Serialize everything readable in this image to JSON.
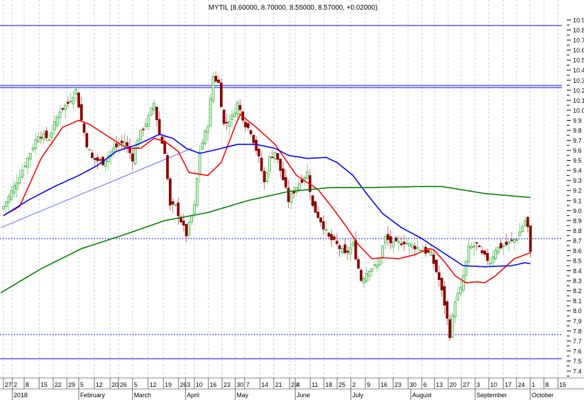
{
  "chart_data": {
    "type": "candlestick",
    "title": "MYTIL (8.60000, 8.70000, 8.55000, 8.57000, +0.02000)",
    "ylim": [
      7.4,
      10.9
    ],
    "y_ticks": [
      "7.4",
      "7.5",
      "7.6",
      "7.7",
      "7.8",
      "7.9",
      "8.0",
      "8.1",
      "8.2",
      "8.3",
      "8.4",
      "8.5",
      "8.6",
      "8.7",
      "8.8",
      "8.9",
      "9.0",
      "9.1",
      "9.2",
      "9.3",
      "9.4",
      "9.5",
      "9.6",
      "9.7",
      "9.8",
      "9.9",
      "10.0",
      "10.1",
      "10.2",
      "10.3",
      "10.4",
      "10.5",
      "10.6",
      "10.7",
      "10.8",
      "10.9"
    ],
    "x_day_range": [
      -1,
      209
    ],
    "week_ticks": [
      {
        "label": "27",
        "day": 0
      },
      {
        "label": "2",
        "day": 3.3
      },
      {
        "label": "8",
        "day": 7.7
      },
      {
        "label": "15",
        "day": 13.3
      },
      {
        "label": "22",
        "day": 18.5
      },
      {
        "label": "29",
        "day": 23.6
      },
      {
        "label": "5",
        "day": 28
      },
      {
        "label": "12",
        "day": 33.8
      },
      {
        "label": "20",
        "day": 39.7
      },
      {
        "label": "26",
        "day": 42.8
      },
      {
        "label": "5",
        "day": 48
      },
      {
        "label": "12",
        "day": 53.8
      },
      {
        "label": "19",
        "day": 59.5
      },
      {
        "label": "26",
        "day": 65.1
      },
      {
        "label": "3",
        "day": 67.7
      },
      {
        "label": "10",
        "day": 71
      },
      {
        "label": "16",
        "day": 76.2
      },
      {
        "label": "23",
        "day": 81.3
      },
      {
        "label": "30",
        "day": 86.2
      },
      {
        "label": "7",
        "day": 89.7
      },
      {
        "label": "14",
        "day": 95.4
      },
      {
        "label": "21",
        "day": 100.5
      },
      {
        "label": "29",
        "day": 106.4
      },
      {
        "label": "4",
        "day": 108.5
      },
      {
        "label": "11",
        "day": 114.1
      },
      {
        "label": "18",
        "day": 119.2
      },
      {
        "label": "25",
        "day": 124.1
      },
      {
        "label": "2",
        "day": 129.2
      },
      {
        "label": "9",
        "day": 134.6
      },
      {
        "label": "16",
        "day": 139.7
      },
      {
        "label": "23",
        "day": 144.9
      },
      {
        "label": "30",
        "day": 150.5
      },
      {
        "label": "6",
        "day": 155.6
      },
      {
        "label": "13",
        "day": 160.3
      },
      {
        "label": "20",
        "day": 165.4
      },
      {
        "label": "27",
        "day": 170.3
      },
      {
        "label": "3",
        "day": 175.4
      },
      {
        "label": "10",
        "day": 180.5
      },
      {
        "label": "17",
        "day": 185.9
      },
      {
        "label": "24",
        "day": 190.8
      },
      {
        "label": "1",
        "day": 195.9
      },
      {
        "label": "8",
        "day": 201
      },
      {
        "label": "15",
        "day": 206.2
      }
    ],
    "month_labels": [
      {
        "label": "2018",
        "day": 3.3
      },
      {
        "label": "February",
        "day": 28
      },
      {
        "label": "March",
        "day": 48
      },
      {
        "label": "April",
        "day": 67.7
      },
      {
        "label": "May",
        "day": 86.2
      },
      {
        "label": "June",
        "day": 108.5
      },
      {
        "label": "July",
        "day": 129.2
      },
      {
        "label": "August",
        "day": 151.5
      },
      {
        "label": "September",
        "day": 175.4
      },
      {
        "label": "October",
        "day": 195.9
      }
    ],
    "close_anchors": [
      [
        0,
        9.04
      ],
      [
        4,
        9.24
      ],
      [
        9,
        9.52
      ],
      [
        13,
        9.76
      ],
      [
        17,
        9.72
      ],
      [
        21,
        10.0
      ],
      [
        24,
        10.07
      ],
      [
        27,
        10.2
      ],
      [
        29,
        9.9
      ],
      [
        31,
        9.66
      ],
      [
        33,
        9.52
      ],
      [
        37,
        9.48
      ],
      [
        41,
        9.62
      ],
      [
        45,
        9.69
      ],
      [
        48,
        9.52
      ],
      [
        50,
        9.72
      ],
      [
        54,
        9.93
      ],
      [
        56,
        10.07
      ],
      [
        58,
        9.76
      ],
      [
        60,
        9.59
      ],
      [
        62,
        9.04
      ],
      [
        64,
        9.04
      ],
      [
        67,
        8.83
      ],
      [
        68,
        8.76
      ],
      [
        71,
        9.04
      ],
      [
        73,
        9.59
      ],
      [
        76,
        9.86
      ],
      [
        78,
        10.34
      ],
      [
        80,
        10.27
      ],
      [
        82,
        9.86
      ],
      [
        85,
        9.93
      ],
      [
        87,
        10.07
      ],
      [
        90,
        9.86
      ],
      [
        92,
        9.79
      ],
      [
        95,
        9.52
      ],
      [
        97,
        9.28
      ],
      [
        99,
        9.52
      ],
      [
        101,
        9.59
      ],
      [
        104,
        9.31
      ],
      [
        106,
        9.1
      ],
      [
        109,
        9.24
      ],
      [
        113,
        9.38
      ],
      [
        115,
        9.04
      ],
      [
        118,
        8.9
      ],
      [
        121,
        8.73
      ],
      [
        124,
        8.66
      ],
      [
        127,
        8.56
      ],
      [
        130,
        8.66
      ],
      [
        133,
        8.31
      ],
      [
        136,
        8.42
      ],
      [
        139,
        8.45
      ],
      [
        142,
        8.73
      ],
      [
        145,
        8.66
      ],
      [
        149,
        8.69
      ],
      [
        151,
        8.66
      ],
      [
        155,
        8.62
      ],
      [
        159,
        8.56
      ],
      [
        162,
        8.31
      ],
      [
        164,
        8.07
      ],
      [
        166,
        7.76
      ],
      [
        168,
        8.11
      ],
      [
        170,
        8.21
      ],
      [
        173,
        8.62
      ],
      [
        176,
        8.66
      ],
      [
        178,
        8.56
      ],
      [
        181,
        8.49
      ],
      [
        183,
        8.62
      ],
      [
        187,
        8.66
      ],
      [
        191,
        8.73
      ],
      [
        194,
        8.9
      ],
      [
        195,
        8.83
      ],
      [
        196,
        8.57
      ]
    ],
    "series": [
      {
        "name": "MA short",
        "color": "#ff0000",
        "points": [
          [
            0,
            8.95
          ],
          [
            6,
            9.04
          ],
          [
            14,
            9.52
          ],
          [
            22,
            9.83
          ],
          [
            28,
            9.9
          ],
          [
            32,
            9.86
          ],
          [
            40,
            9.72
          ],
          [
            46,
            9.62
          ],
          [
            51,
            9.62
          ],
          [
            56,
            9.72
          ],
          [
            60,
            9.69
          ],
          [
            65,
            9.59
          ],
          [
            69,
            9.38
          ],
          [
            76,
            9.35
          ],
          [
            81,
            9.48
          ],
          [
            86,
            9.83
          ],
          [
            88,
            9.96
          ],
          [
            94,
            9.83
          ],
          [
            101,
            9.66
          ],
          [
            109,
            9.35
          ],
          [
            117,
            9.21
          ],
          [
            122,
            9.04
          ],
          [
            127,
            8.86
          ],
          [
            132,
            8.66
          ],
          [
            137,
            8.52
          ],
          [
            141,
            8.53
          ],
          [
            147,
            8.52
          ],
          [
            153,
            8.56
          ],
          [
            158,
            8.62
          ],
          [
            160,
            8.61
          ],
          [
            164,
            8.49
          ],
          [
            168,
            8.35
          ],
          [
            172,
            8.28
          ],
          [
            176,
            8.29
          ],
          [
            179,
            8.28
          ],
          [
            183,
            8.35
          ],
          [
            190,
            8.52
          ],
          [
            196,
            8.58
          ]
        ]
      },
      {
        "name": "MA medium",
        "color": "#0000ff",
        "points": [
          [
            0,
            8.95
          ],
          [
            9,
            9.1
          ],
          [
            19,
            9.24
          ],
          [
            28,
            9.35
          ],
          [
            35,
            9.45
          ],
          [
            42,
            9.59
          ],
          [
            50,
            9.66
          ],
          [
            58,
            9.76
          ],
          [
            63,
            9.72
          ],
          [
            68,
            9.62
          ],
          [
            73,
            9.57
          ],
          [
            78,
            9.6
          ],
          [
            87,
            9.66
          ],
          [
            94,
            9.66
          ],
          [
            101,
            9.62
          ],
          [
            106,
            9.55
          ],
          [
            113,
            9.52
          ],
          [
            120,
            9.53
          ],
          [
            124,
            9.48
          ],
          [
            130,
            9.35
          ],
          [
            135,
            9.17
          ],
          [
            141,
            8.97
          ],
          [
            148,
            8.83
          ],
          [
            155,
            8.73
          ],
          [
            163,
            8.59
          ],
          [
            171,
            8.45
          ],
          [
            179,
            8.44
          ],
          [
            189,
            8.45
          ],
          [
            194,
            8.48
          ],
          [
            196,
            8.47
          ]
        ]
      },
      {
        "name": "MA long",
        "color": "#008000",
        "points": [
          [
            -1,
            8.18
          ],
          [
            14,
            8.42
          ],
          [
            29,
            8.62
          ],
          [
            45,
            8.76
          ],
          [
            60,
            8.9
          ],
          [
            76,
            8.98
          ],
          [
            91,
            9.1
          ],
          [
            106,
            9.19
          ],
          [
            122,
            9.23
          ],
          [
            137,
            9.23
          ],
          [
            155,
            9.24
          ],
          [
            163,
            9.24
          ],
          [
            179,
            9.17
          ],
          [
            196,
            9.13
          ]
        ]
      }
    ],
    "horizontal_lines": [
      {
        "price": 10.845,
        "style": "solid"
      },
      {
        "price": 10.247,
        "style": "solid"
      },
      {
        "price": 10.226,
        "style": "solid"
      },
      {
        "price": 8.72,
        "style": "dotted"
      },
      {
        "price": 7.764,
        "style": "dotted"
      },
      {
        "price": 7.523,
        "style": "solid"
      }
    ],
    "trend_line": {
      "start": [
        -1,
        8.83
      ],
      "end": [
        70,
        9.62
      ]
    },
    "colors": {
      "up": "#3cb043",
      "up_fill": "#d6f5d6",
      "down": "#8b0000",
      "line": "#0000ff",
      "grid": "#cfcfcf"
    }
  }
}
